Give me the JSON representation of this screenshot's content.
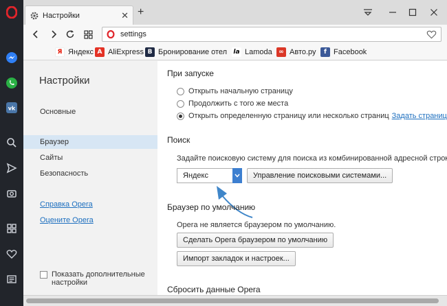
{
  "sidebar_icons": [
    "messenger-icon",
    "whatsapp-icon",
    "vk-icon",
    "search-icon",
    "send-icon",
    "camera-icon",
    "speed-dial-icon",
    "heart-icon",
    "news-icon"
  ],
  "tab": {
    "title": "Настройки"
  },
  "address": {
    "url": "settings"
  },
  "bookmarks": [
    {
      "label": "Яндекс",
      "color": "#ffffff",
      "glyph": "Я",
      "fg": "#e61400"
    },
    {
      "label": "AliExpress",
      "color": "#e43225",
      "glyph": "A",
      "fg": "#ffffff"
    },
    {
      "label": "Бронирование отел",
      "color": "#1f2a44",
      "glyph": "B",
      "fg": "#ffffff"
    },
    {
      "label": "Lamoda",
      "color": "#ffffff",
      "glyph": "la",
      "fg": "#000000"
    },
    {
      "label": "Авто.ру",
      "color": "#db3727",
      "glyph": "∞",
      "fg": "#ffffff"
    },
    {
      "label": "Facebook",
      "color": "#3b5998",
      "glyph": "f",
      "fg": "#ffffff"
    }
  ],
  "nav": {
    "title": "Настройки",
    "items": [
      "Основные",
      "Браузер",
      "Сайты",
      "Безопасность"
    ],
    "active": "Браузер",
    "links": [
      "Справка Opera",
      "Оцените Opera"
    ],
    "show_advanced": "Показать дополнительные настройки"
  },
  "startup": {
    "title": "При запуске",
    "options": [
      "Открыть начальную страницу",
      "Продолжить с того же места",
      "Открыть определенную страницу или несколько страниц"
    ],
    "selected_index": 2,
    "set_pages_link": "Задать страницы"
  },
  "search": {
    "title": "Поиск",
    "description": "Задайте поисковую систему для поиска из комбинированной адресной строки",
    "engine": "Яндекс",
    "manage_button": "Управление поисковыми системами..."
  },
  "default_browser": {
    "title": "Браузер по умолчанию",
    "status": "Opera не является браузером по умолчанию.",
    "make_default_button": "Сделать Opera браузером по умолчанию",
    "import_button": "Импорт закладок и настроек..."
  },
  "reset": {
    "title": "Сбросить данные Opera"
  },
  "colors": {
    "accent": "#3d7fd0",
    "link": "#1d6fbf",
    "opera_red": "#e0252b"
  }
}
